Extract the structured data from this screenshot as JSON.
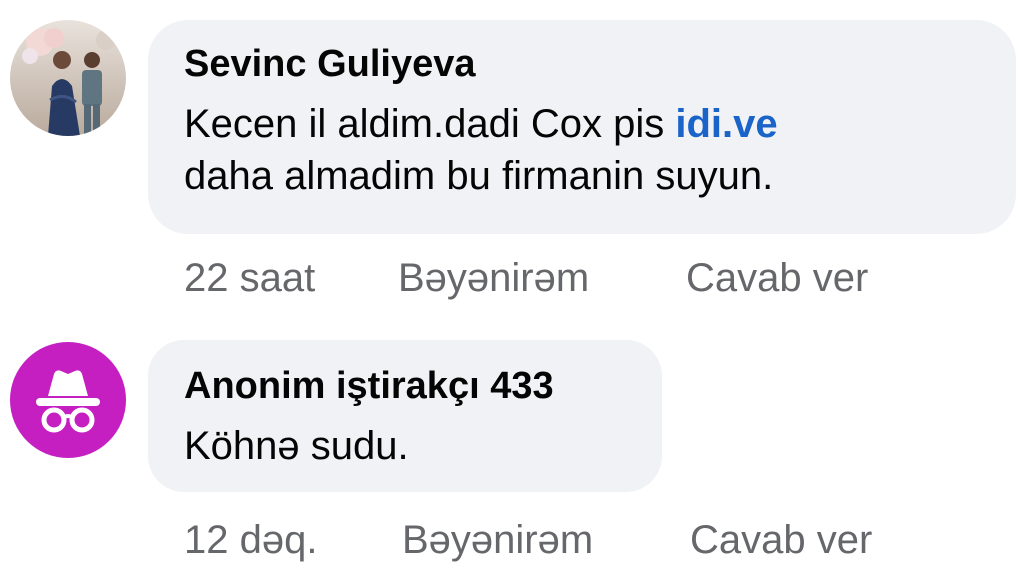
{
  "comments": [
    {
      "author": "Sevinc Guliyeva",
      "text_line1": "Kecen il aldim.dadi Cox pis ",
      "text_link": "idi.ve",
      "text_line2": "daha almadim bu firmanin suyun.",
      "time": "22 saat",
      "like_label": "Bəyənirəm",
      "reply_label": "Cavab ver"
    },
    {
      "author": "Anonim iştirakçı 433",
      "text": "Köhnə sudu.",
      "time": "12 dəq.",
      "like_label": "Bəyənirəm",
      "reply_label": "Cavab ver"
    }
  ],
  "colors": {
    "bubble": "#f0f2f5",
    "link": "#1a63c8",
    "meta": "#65676b",
    "anon_avatar": "#c51fc2"
  },
  "icons": {
    "profile_avatar": "profile-photo",
    "anon_avatar": "incognito-icon"
  }
}
